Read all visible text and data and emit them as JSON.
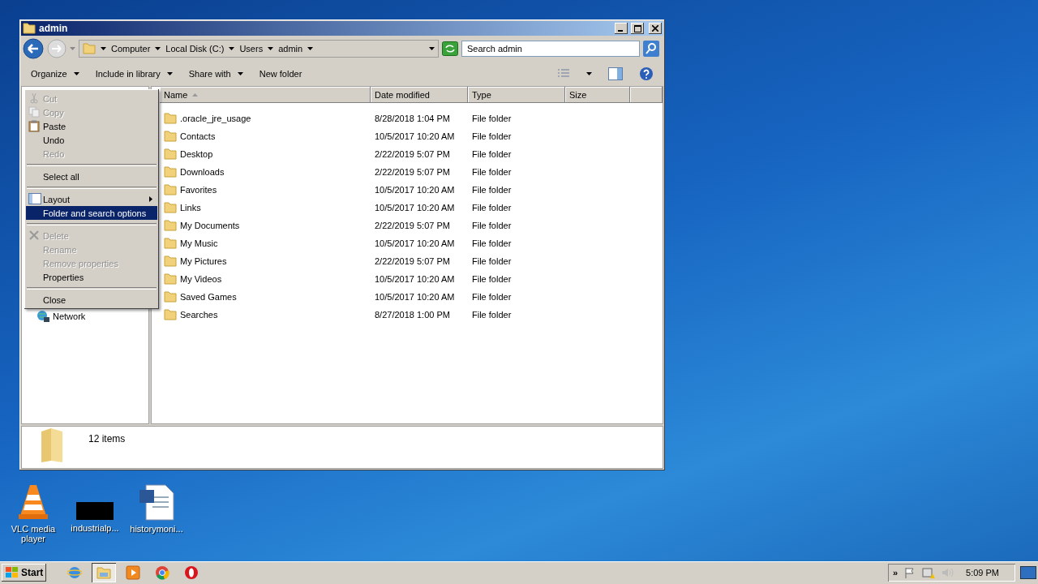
{
  "window": {
    "title": "admin"
  },
  "address": {
    "crumbs": [
      "Computer",
      "Local Disk (C:)",
      "Users",
      "admin"
    ]
  },
  "search": {
    "placeholder": "Search admin"
  },
  "toolbar": {
    "buttons": [
      {
        "label": "Organize",
        "dropdown": true
      },
      {
        "label": "Include in library",
        "dropdown": true
      },
      {
        "label": "Share with",
        "dropdown": true
      },
      {
        "label": "New folder",
        "dropdown": false
      }
    ]
  },
  "context_menu": {
    "items": [
      {
        "kind": "item",
        "label": "Cut",
        "disabled": true,
        "selected": false
      },
      {
        "kind": "item",
        "label": "Copy",
        "disabled": true,
        "selected": false
      },
      {
        "kind": "item",
        "label": "Paste",
        "disabled": false,
        "selected": false
      },
      {
        "kind": "item",
        "label": "Undo",
        "disabled": false,
        "selected": false
      },
      {
        "kind": "item",
        "label": "Redo",
        "disabled": true,
        "selected": false
      },
      {
        "kind": "separator"
      },
      {
        "kind": "item",
        "label": "Select all",
        "disabled": false,
        "selected": false
      },
      {
        "kind": "separator"
      },
      {
        "kind": "submenu",
        "label": "Layout",
        "disabled": false,
        "selected": false
      },
      {
        "kind": "item",
        "label": "Folder and search options",
        "disabled": false,
        "selected": true
      },
      {
        "kind": "separator"
      },
      {
        "kind": "item",
        "label": "Delete",
        "disabled": true,
        "selected": false
      },
      {
        "kind": "item",
        "label": "Rename",
        "disabled": true,
        "selected": false
      },
      {
        "kind": "item",
        "label": "Remove properties",
        "disabled": true,
        "selected": false
      },
      {
        "kind": "item",
        "label": "Properties",
        "disabled": false,
        "selected": false
      },
      {
        "kind": "separator"
      },
      {
        "kind": "item",
        "label": "Close",
        "disabled": false,
        "selected": false
      }
    ]
  },
  "nav_pane": {
    "items": [
      "Network"
    ]
  },
  "table": {
    "columns": [
      "Name",
      "Date modified",
      "Type",
      "Size"
    ],
    "rows": [
      {
        "name": ".oracle_jre_usage",
        "date": "8/28/2018 1:04 PM",
        "type": "File folder"
      },
      {
        "name": "Contacts",
        "date": "10/5/2017 10:20 AM",
        "type": "File folder"
      },
      {
        "name": "Desktop",
        "date": "2/22/2019 5:07 PM",
        "type": "File folder"
      },
      {
        "name": "Downloads",
        "date": "2/22/2019 5:07 PM",
        "type": "File folder"
      },
      {
        "name": "Favorites",
        "date": "10/5/2017 10:20 AM",
        "type": "File folder"
      },
      {
        "name": "Links",
        "date": "10/5/2017 10:20 AM",
        "type": "File folder"
      },
      {
        "name": "My Documents",
        "date": "2/22/2019 5:07 PM",
        "type": "File folder"
      },
      {
        "name": "My Music",
        "date": "10/5/2017 10:20 AM",
        "type": "File folder"
      },
      {
        "name": "My Pictures",
        "date": "2/22/2019 5:07 PM",
        "type": "File folder"
      },
      {
        "name": "My Videos",
        "date": "10/5/2017 10:20 AM",
        "type": "File folder"
      },
      {
        "name": "Saved Games",
        "date": "10/5/2017 10:20 AM",
        "type": "File folder"
      },
      {
        "name": "Searches",
        "date": "8/27/2018 1:00 PM",
        "type": "File folder"
      }
    ]
  },
  "details_pane": {
    "text": "12 items"
  },
  "desktop_icons": [
    {
      "kind": "vlc",
      "label": "VLC media player"
    },
    {
      "kind": "blank",
      "label": "industrialp..."
    },
    {
      "kind": "word",
      "label": "historymoni..."
    }
  ],
  "taskbar": {
    "start": "Start",
    "apps": [
      {
        "kind": "ie",
        "selected": false
      },
      {
        "kind": "explorer",
        "selected": true
      },
      {
        "kind": "media",
        "selected": false
      },
      {
        "kind": "chrome",
        "selected": false
      },
      {
        "kind": "opera",
        "selected": false
      }
    ],
    "tray_chevron": "»",
    "time": "5:09 PM"
  }
}
